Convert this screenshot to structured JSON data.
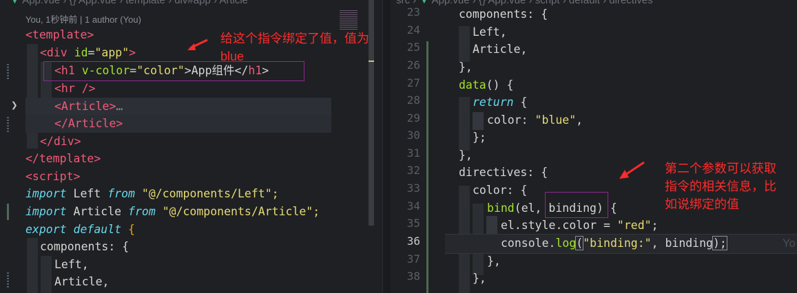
{
  "left_pane": {
    "breadcrumb": [
      "App.vue",
      "{}",
      "App.vue",
      "template",
      "div#app",
      "Article"
    ],
    "blame": "You, 1秒钟前 | 1 author (You)",
    "annotation": "给这个指令绑定了值，值为blue",
    "lines": {
      "l1": "<template>",
      "l2_open": "<div ",
      "l2_attr": "id",
      "l2_eq": "=",
      "l2_val": "\"app\"",
      "l2_close": ">",
      "l3_open": "<h1 ",
      "l3_attr": "v-color",
      "l3_eq": "=",
      "l3_val": "\"color\"",
      "l3_text": ">App组件</",
      "l3_tag": "h1",
      "l3_end": ">",
      "l4": "<hr />",
      "l5": "<Article>",
      "l5_fold": "…",
      "l6": "</Article>",
      "l7": "</div>",
      "l8": "</template>",
      "l9": "<script>",
      "l10_kw": "import",
      "l10_id": " Left ",
      "l10_from": "from",
      "l10_str": " \"@/components/Left\";",
      "l11_kw": "import",
      "l11_id": " Article ",
      "l11_from": "from",
      "l11_str": " \"@/components/Article\";",
      "l12_kw1": "export",
      "l12_kw2": " default ",
      "l12_brace": "{",
      "l13": "components: {",
      "l14": "Left,",
      "l15": "Article,"
    }
  },
  "right_pane": {
    "breadcrumb": [
      "src",
      "App.vue",
      "{}",
      "App.vue",
      "script",
      "default",
      "directives"
    ],
    "annotation_lines": [
      "第二个参数可以获取",
      "指令的相关信息，比",
      "如说绑定的值"
    ],
    "ghost": "Yo",
    "line_numbers": [
      "23",
      "24",
      "25",
      "26",
      "27",
      "28",
      "29",
      "30",
      "31",
      "32",
      "33",
      "34",
      "35",
      "36",
      "37",
      "38"
    ],
    "active_line": "36",
    "code": {
      "r23": "components: {",
      "r24": "Left,",
      "r25": "Article,",
      "r26": "},",
      "r27_fn": "data",
      "r27_rest": "() {",
      "r28_kw": "return",
      "r28_rest": " {",
      "r29_key": "color: ",
      "r29_val": "\"blue\"",
      "r29_end": ",",
      "r30": "};",
      "r31": "},",
      "r32": "directives: {",
      "r33": "color: {",
      "r34_fn": "bind",
      "r34_open": "(",
      "r34_args": "el, binding",
      "r34_close": ") {",
      "r35_prop": "el.style.color = ",
      "r35_val": "\"red\"",
      "r35_end": ";",
      "r36_a": "console.",
      "r36_fn": "log",
      "r36_open": "(",
      "r36_str": "\"binding:\"",
      "r36_rest": ", binding",
      "r36_close": ");",
      "r37": "},",
      "r38": "},"
    }
  }
}
